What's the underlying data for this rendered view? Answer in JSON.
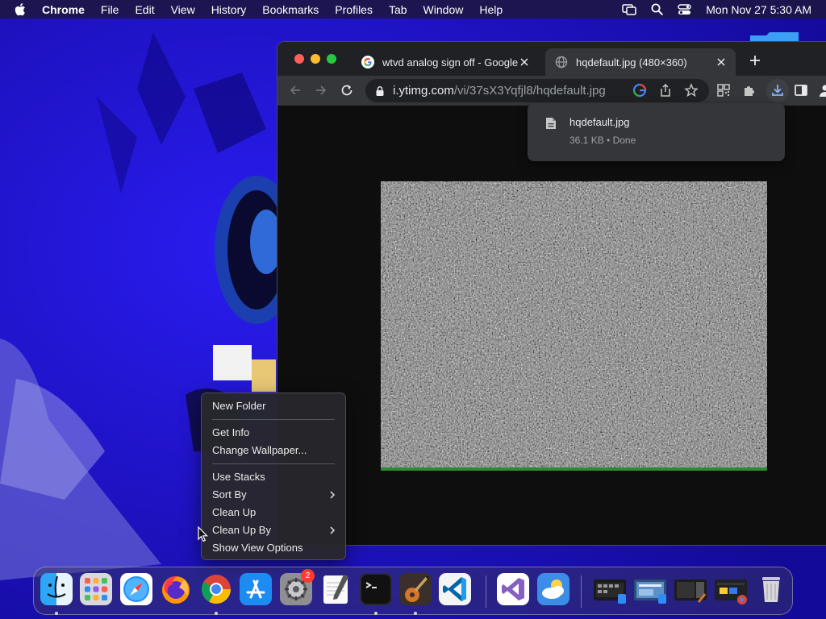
{
  "menubar": {
    "items": [
      "Chrome",
      "File",
      "Edit",
      "View",
      "History",
      "Bookmarks",
      "Profiles",
      "Tab",
      "Window",
      "Help"
    ],
    "clock": "Mon Nov 27  5:30 AM"
  },
  "browser": {
    "tabs": [
      {
        "title": "wtvd analog sign off - Google S",
        "favicon": "google-g-icon",
        "active": false
      },
      {
        "title": "hqdefault.jpg (480×360)",
        "favicon": "globe-icon",
        "active": true
      }
    ],
    "omnibox": {
      "host": "i.ytimg.com",
      "path": "/vi/37sX3Yqfjl8/hqdefault.jpg"
    },
    "download": {
      "filename": "hqdefault.jpg",
      "status": "36.1 KB • Done"
    }
  },
  "context_menu": {
    "groups": [
      [
        {
          "label": "New Folder",
          "submenu": false
        }
      ],
      [
        {
          "label": "Get Info",
          "submenu": false
        },
        {
          "label": "Change Wallpaper...",
          "submenu": false
        }
      ],
      [
        {
          "label": "Use Stacks",
          "submenu": false
        },
        {
          "label": "Sort By",
          "submenu": true
        },
        {
          "label": "Clean Up",
          "submenu": false
        },
        {
          "label": "Clean Up By",
          "submenu": true
        },
        {
          "label": "Show View Options",
          "submenu": false
        }
      ]
    ]
  },
  "dock": {
    "system_settings_badge": "2",
    "apps": [
      "finder-icon",
      "launchpad-icon",
      "safari-icon",
      "firefox-icon",
      "chrome-icon",
      "app-store-icon",
      "system-settings-icon",
      "textedit-icon",
      "terminal-icon",
      "garageband-icon",
      "vscode-icon",
      "visual-studio-icon",
      "weather-icon"
    ]
  },
  "colors": {
    "wallpaper_blue": "#1d10c8",
    "chrome_dark": "#202124",
    "chrome_toolbar": "#35363a",
    "download_accent": "#8ab4f8"
  }
}
